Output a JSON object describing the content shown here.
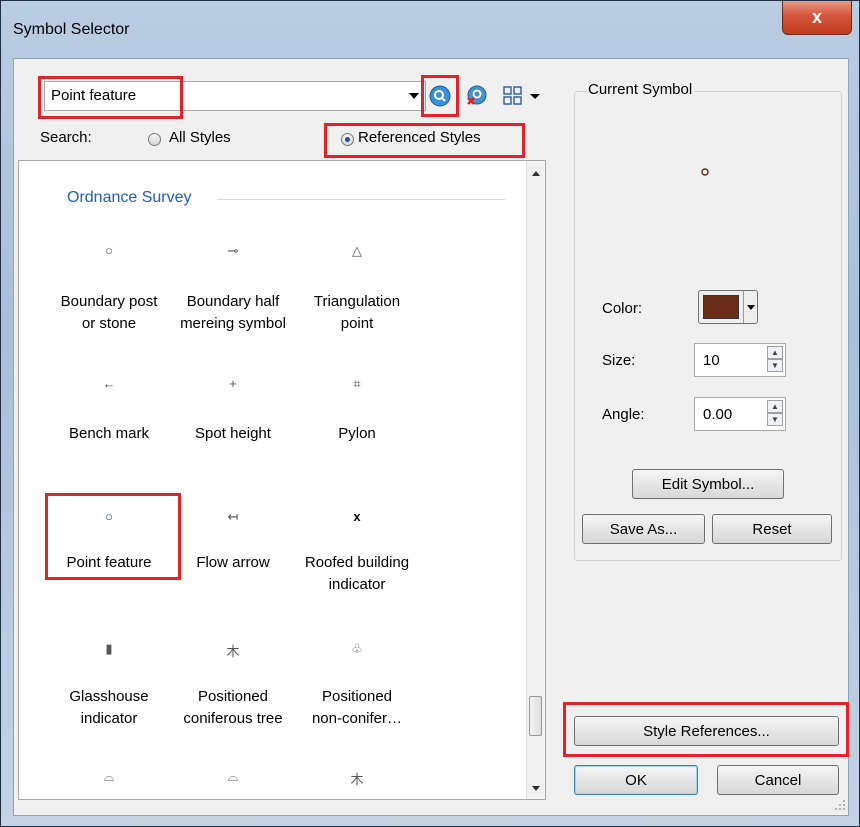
{
  "window": {
    "title": "Symbol Selector",
    "close_glyph": "x"
  },
  "search": {
    "combo_value": "Point feature",
    "label": "Search:",
    "all_styles_label": "All Styles",
    "referenced_styles_label": "Referenced Styles",
    "selected_scope": "Referenced Styles"
  },
  "symbols": {
    "group_title": "Ordnance Survey",
    "items": [
      {
        "label_1": "Boundary post",
        "label_2": "or stone",
        "glyph": "○"
      },
      {
        "label_1": "Boundary half",
        "label_2": "mereing symbol",
        "glyph": "⊸"
      },
      {
        "label_1": "Triangulation",
        "label_2": "point",
        "glyph": "△"
      },
      {
        "label_1": "Bench mark",
        "label_2": "",
        "glyph": "←"
      },
      {
        "label_1": "Spot height",
        "label_2": "",
        "glyph": "+"
      },
      {
        "label_1": "Pylon",
        "label_2": "",
        "glyph": "⌗"
      },
      {
        "label_1": "Point feature",
        "label_2": "",
        "glyph": "○"
      },
      {
        "label_1": "Flow arrow",
        "label_2": "",
        "glyph": "↤"
      },
      {
        "label_1": "Roofed building",
        "label_2": "indicator",
        "glyph": "x"
      },
      {
        "label_1": "Glasshouse",
        "label_2": "indicator",
        "glyph": "▮"
      },
      {
        "label_1": "Positioned",
        "label_2": "coniferous tree",
        "glyph": "⽊"
      },
      {
        "label_1": "Positioned",
        "label_2": "non-conifer…",
        "glyph": "♧"
      },
      {
        "label_1": "",
        "label_2": "",
        "glyph": "⌓"
      },
      {
        "label_1": "",
        "label_2": "",
        "glyph": "⌓"
      },
      {
        "label_1": "",
        "label_2": "",
        "glyph": "⽊"
      }
    ]
  },
  "current_symbol": {
    "group_label": "Current Symbol",
    "color_label": "Color:",
    "color_value": "#6b2c17",
    "size_label": "Size:",
    "size_value": "10",
    "angle_label": "Angle:",
    "angle_value": "0.00",
    "edit_symbol_label": "Edit Symbol...",
    "save_as_label": "Save As...",
    "reset_label": "Reset"
  },
  "footer": {
    "style_references_label": "Style References...",
    "ok_label": "OK",
    "cancel_label": "Cancel"
  },
  "colors": {
    "highlight": "#e52129",
    "link_blue": "#1f5fb5",
    "symbol_color": "#6b2c17"
  }
}
